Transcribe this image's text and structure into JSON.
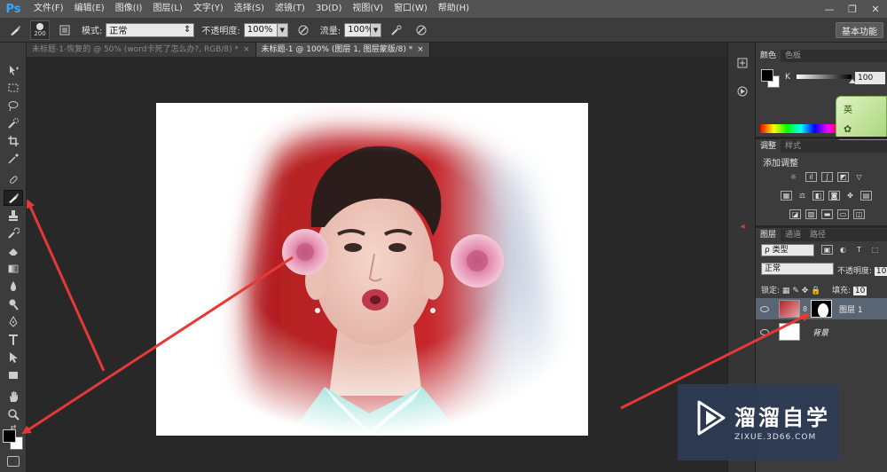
{
  "app": {
    "logo": "Ps"
  },
  "menu": [
    "文件(F)",
    "编辑(E)",
    "图像(I)",
    "图层(L)",
    "文字(Y)",
    "选择(S)",
    "滤镜(T)",
    "3D(D)",
    "视图(V)",
    "窗口(W)",
    "帮助(H)"
  ],
  "window_controls": {
    "minimize": "—",
    "restore": "❐",
    "close": "✕"
  },
  "options": {
    "brush_size": "200",
    "mode_label": "模式:",
    "mode_value": "正常",
    "opacity_label": "不透明度:",
    "opacity_value": "100%",
    "flow_label": "流量:",
    "flow_value": "100%",
    "workspace": "基本功能"
  },
  "tabs": [
    {
      "label": "未标题-1-恢复的 @ 50% (word卡死了怎么办?, RGB/8) *",
      "active": false
    },
    {
      "label": "未标题-1 @ 100% (图层 1, 图层蒙版/8) *",
      "active": true
    }
  ],
  "tools": [
    "move",
    "marquee",
    "lasso",
    "quick-select",
    "crop",
    "eyedropper",
    "healing",
    "brush",
    "stamp",
    "history-brush",
    "eraser",
    "gradient",
    "blur",
    "dodge",
    "pen",
    "type",
    "path-select",
    "shape",
    "hand",
    "zoom"
  ],
  "color_panel": {
    "tabs": [
      "颜色",
      "色板"
    ],
    "k_label": "K",
    "k_value": "100",
    "ime_label": "英"
  },
  "adjust_panel": {
    "tabs": [
      "调整",
      "样式"
    ],
    "title": "添加调整"
  },
  "layers_panel": {
    "tabs": [
      "图层",
      "通道",
      "路径"
    ],
    "filter": "ρ 类型",
    "blend": "正常",
    "opacity_label": "不透明度:",
    "opacity_value": "10",
    "lock_label": "锁定:",
    "fill_label": "填充:",
    "fill_value": "10",
    "layers": [
      {
        "name": "图层 1",
        "selected": true
      },
      {
        "name": "背景",
        "selected": false
      }
    ]
  },
  "watermark": {
    "title": "溜溜自学",
    "url": "ZIXUE.3D66.COM"
  },
  "colors": {
    "accent": "#31a8ff",
    "arrow": "#e53935"
  }
}
